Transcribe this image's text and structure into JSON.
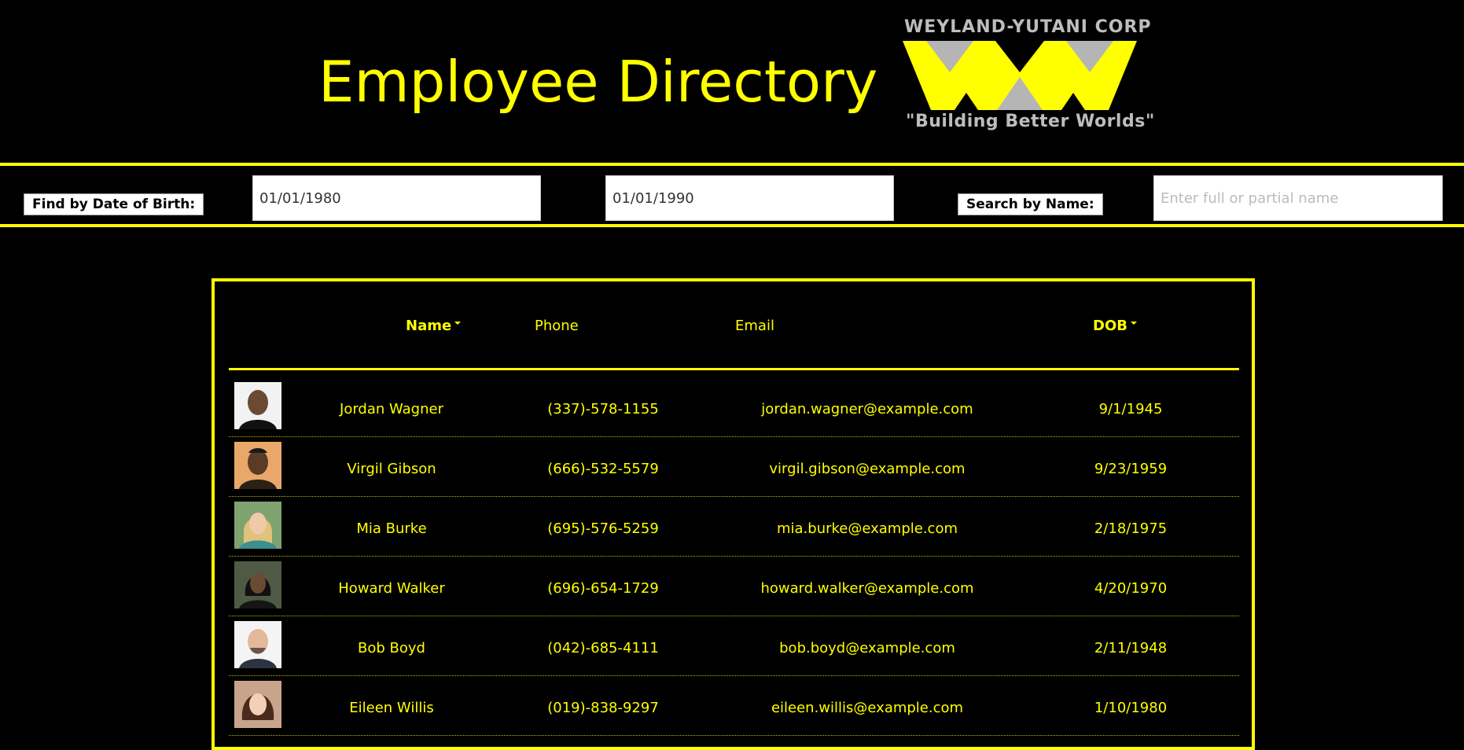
{
  "header": {
    "title": "Employee Directory",
    "logo_top": "WEYLAND-YUTANI CORP",
    "logo_tagline": "\"Building Better Worlds\"",
    "logo_icon": "weyland-yutani-wings-logo"
  },
  "filters": {
    "dob_label": "Find by Date of Birth:",
    "dob_start": "01/01/1980",
    "dob_end": "01/01/1990",
    "name_label": "Search by Name:",
    "name_placeholder": "Enter full or partial name"
  },
  "table": {
    "columns": {
      "name": "Name",
      "phone": "Phone",
      "email": "Email",
      "dob": "DOB"
    },
    "rows": [
      {
        "name": "Jordan Wagner",
        "phone": "(337)-578-1155",
        "email": "jordan.wagner@example.com",
        "dob": "9/1/1945"
      },
      {
        "name": "Virgil Gibson",
        "phone": "(666)-532-5579",
        "email": "virgil.gibson@example.com",
        "dob": "9/23/1959"
      },
      {
        "name": "Mia Burke",
        "phone": "(695)-576-5259",
        "email": "mia.burke@example.com",
        "dob": "2/18/1975"
      },
      {
        "name": "Howard Walker",
        "phone": "(696)-654-1729",
        "email": "howard.walker@example.com",
        "dob": "4/20/1970"
      },
      {
        "name": "Bob Boyd",
        "phone": "(042)-685-4111",
        "email": "bob.boyd@example.com",
        "dob": "2/11/1948"
      },
      {
        "name": "Eileen Willis",
        "phone": "(019)-838-9297",
        "email": "eileen.willis@example.com",
        "dob": "1/10/1980"
      }
    ]
  },
  "colors": {
    "accent": "#ffff00",
    "background": "#000000",
    "logo_gray": "#bdbdbd"
  }
}
